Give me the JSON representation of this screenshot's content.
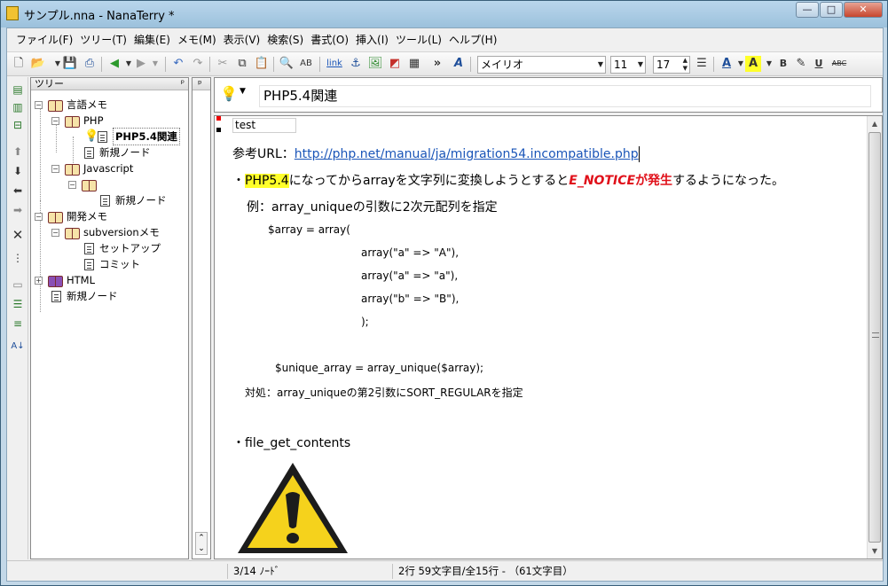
{
  "window": {
    "title": "サンプル.nna - NanaTerry *",
    "buttons": {
      "minimize": "—",
      "maximize": "□",
      "close": "✕"
    }
  },
  "menu": [
    "ファイル(F)",
    "ツリー(T)",
    "編集(E)",
    "メモ(M)",
    "表示(V)",
    "検索(S)",
    "書式(O)",
    "挿入(I)",
    "ツール(L)",
    "ヘルプ(H)"
  ],
  "toolbar": {
    "link_label": "link",
    "font_name": "メイリオ",
    "font_size": "11",
    "line_spacing": "17",
    "bold": "B",
    "underline": "U",
    "strike": "ABC",
    "more": "»"
  },
  "tree": {
    "header": "ツリー",
    "pin": "ᵖ",
    "nodes": {
      "gengo": "言語メモ",
      "php": "PHP",
      "php54": "PHP5.4関連",
      "new1": "新規ノード",
      "javascript": "Javascript",
      "new2": "新規ノード",
      "kaihatsu": "開発メモ",
      "subversion": "subversionメモ",
      "setup": "セットアップ",
      "commit": "コミット",
      "html": "HTML",
      "new3": "新規ノード"
    }
  },
  "mid": {
    "pin": "ᵖ"
  },
  "memo": {
    "title": "PHP5.4関連",
    "tag": "test",
    "ref_label": "参考URL：",
    "ref_url": "http://php.net/manual/ja/migration54.incompatible.php",
    "bullet1_prefix": "・",
    "bullet1_hl": "PHP5.4",
    "bullet1_mid": "になってからarrayを文字列に変換しようとすると",
    "bullet1_red1": "E_NOTICE",
    "bullet1_red2": "が発生",
    "bullet1_end": "するようになった。",
    "example": "例：array_uniqueの引数に2次元配列を指定",
    "code1": "$array = array(",
    "code2": "array(\"a\" => \"A\"),",
    "code3": "array(\"a\" => \"a\"),",
    "code4": "array(\"b\" => \"B\"),",
    "code5": ");",
    "code6": "$unique_array = array_unique($array);",
    "fix": "対処：array_uniqueの第2引数にSORT_REGULARを指定",
    "bullet2": "・file_get_contents"
  },
  "status": {
    "nodes": "3/14 ﾉｰﾄﾞ",
    "position": "2行 59文字目/全15行 - （61文字目）"
  }
}
